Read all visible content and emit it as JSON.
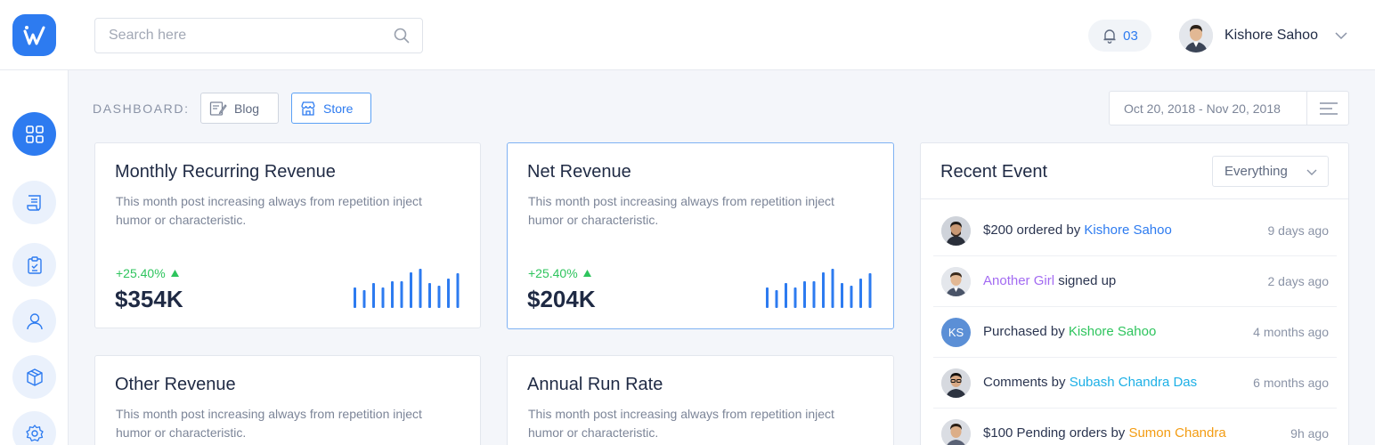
{
  "header": {
    "search_placeholder": "Search here",
    "notification_count": "03",
    "user_name": "Kishore Sahoo"
  },
  "sidebar": {
    "items": [
      {
        "icon": "grid-icon",
        "active": true
      },
      {
        "icon": "document-icon",
        "active": false
      },
      {
        "icon": "clipboard-check-icon",
        "active": false
      },
      {
        "icon": "user-icon",
        "active": false
      },
      {
        "icon": "box-icon",
        "active": false
      },
      {
        "icon": "settings-icon",
        "active": false
      }
    ]
  },
  "toolbar": {
    "dashboard_label": "DASHBOARD:",
    "blog_label": "Blog",
    "store_label": "Store",
    "date_range": "Oct 20, 2018 - Nov 20, 2018"
  },
  "cards": [
    {
      "title": "Monthly Recurring Revenue",
      "description": "This month post increasing always from repetition inject humor or characteristic.",
      "delta": "+25.40%",
      "amount": "$354K",
      "sparkline": [
        0.45,
        0.4,
        0.55,
        0.45,
        0.6,
        0.6,
        0.8,
        0.88,
        0.55,
        0.5,
        0.65,
        0.78,
        1.0
      ]
    },
    {
      "title": "Net Revenue",
      "description": "This month post increasing always from repetition inject humor or characteristic.",
      "delta": "+25.40%",
      "amount": "$204K",
      "sparkline": [
        0.45,
        0.4,
        0.55,
        0.45,
        0.6,
        0.6,
        0.8,
        0.88,
        0.55,
        0.5,
        0.65,
        0.78,
        1.0
      ]
    },
    {
      "title": "Other Revenue",
      "description": "This month post increasing always from repetition inject humor or characteristic."
    },
    {
      "title": "Annual Run Rate",
      "description": "This month post increasing always from repetition inject humor or characteristic."
    }
  ],
  "recent_event": {
    "title": "Recent Event",
    "filter_value": "Everything",
    "events": [
      {
        "prefix": "$200 ordered by ",
        "highlight": "Kishore Sahoo",
        "suffix": "",
        "color": "#2d7bf0",
        "time": "9 days ago",
        "avatar": "photo"
      },
      {
        "prefix": "",
        "highlight": "Another Girl",
        "suffix": " signed up",
        "color": "#a36bf2",
        "time": "2 days ago",
        "avatar": "photo"
      },
      {
        "prefix": "Purchased by ",
        "highlight": "Kishore Sahoo",
        "suffix": "",
        "color": "#2ec45d",
        "time": "4 months ago",
        "avatar": "KS"
      },
      {
        "prefix": "Comments by ",
        "highlight": "Subash Chandra Das",
        "suffix": "",
        "color": "#1db0e6",
        "time": "6 months ago",
        "avatar": "photo"
      },
      {
        "prefix": "$100 Pending orders by ",
        "highlight": "Sumon Chandra",
        "suffix": "",
        "color": "#f39c12",
        "time": "9h ago",
        "avatar": "photo"
      }
    ]
  },
  "colors": {
    "accent": "#2d7bf0",
    "positive": "#2ec45d"
  }
}
